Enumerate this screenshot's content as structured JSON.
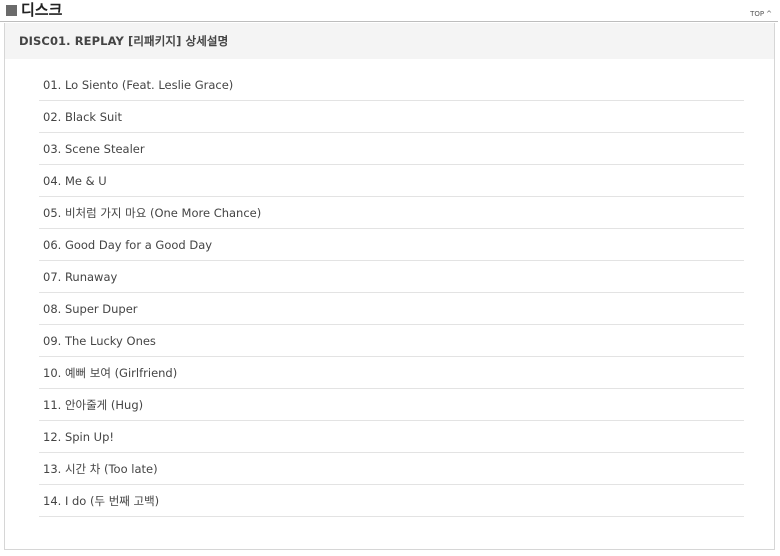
{
  "section": {
    "title": "디스크",
    "top_label": "TOP",
    "top_caret": "^"
  },
  "disc": {
    "title": "DISC01.  REPLAY [리패키지] 상세설명",
    "tracks": [
      "01. Lo Siento (Feat. Leslie Grace)",
      "02. Black Suit",
      "03. Scene Stealer",
      "04. Me & U",
      "05. 비처럼 가지 마요 (One More Chance)",
      "06. Good Day for a Good Day",
      "07. Runaway",
      "08. Super Duper",
      "09. The Lucky Ones",
      "10. 예뻐 보여 (Girlfriend)",
      "11. 안아줄게 (Hug)",
      "12. Spin Up!",
      "13. 시간 차 (Too late)",
      "14. I do (두 번째 고백)"
    ]
  }
}
